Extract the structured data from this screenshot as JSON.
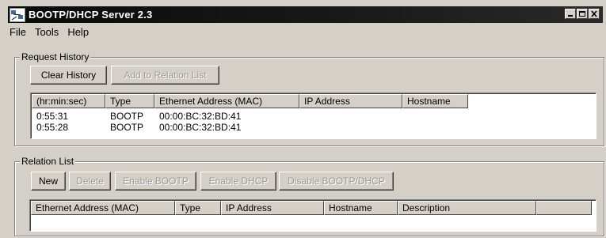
{
  "window": {
    "title": "BOOTP/DHCP Server 2.3"
  },
  "menu": {
    "file": "File",
    "tools": "Tools",
    "help": "Help"
  },
  "request_history": {
    "label": "Request History",
    "clear_label": "Clear History",
    "add_label": "Add to Relation List",
    "columns": [
      "(hr:min:sec)",
      "Type",
      "Ethernet Address (MAC)",
      "IP Address",
      "Hostname"
    ],
    "rows": [
      [
        "0:55:31",
        "BOOTP",
        "00:00:BC:32:BD:41",
        "",
        ""
      ],
      [
        "0:55:28",
        "BOOTP",
        "00:00:BC:32:BD:41",
        "",
        ""
      ]
    ]
  },
  "relation_list": {
    "label": "Relation List",
    "new_label": "New",
    "delete_label": "Delete",
    "enable_bootp_label": "Enable BOOTP",
    "enable_dhcp_label": "Enable DHCP",
    "disable_label": "Disable BOOTP/DHCP",
    "columns": [
      "Ethernet Address (MAC)",
      "Type",
      "IP Address",
      "Hostname",
      "Description"
    ]
  }
}
